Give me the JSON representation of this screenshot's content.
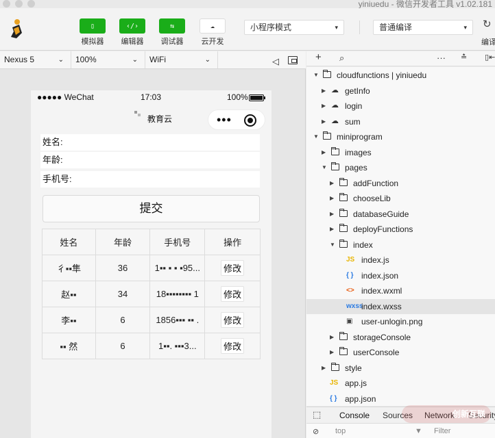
{
  "window": {
    "title": "yiniuedu - 微信开发者工具 v1.02.181"
  },
  "toolbar": {
    "buttons": [
      {
        "label": "模拟器",
        "icon": "phone-icon"
      },
      {
        "label": "编辑器",
        "icon": "code-icon"
      },
      {
        "label": "调试器",
        "icon": "debug-icon"
      },
      {
        "label": "云开发",
        "icon": "cloud-icon"
      }
    ],
    "mode_select": "小程序模式",
    "compile_select": "普通编译",
    "compile_label": "编译",
    "accent": "#1aad19"
  },
  "device_bar": {
    "device": "Nexus 5",
    "zoom": "100%",
    "network": "WiFi"
  },
  "phone": {
    "status": {
      "carrier": "●●●●● WeChat",
      "time": "17:03",
      "battery": "100%"
    },
    "nav_title": "教育云",
    "form": {
      "name_label": "姓名:",
      "age_label": "年龄:",
      "phone_label": "手机号:",
      "submit_label": "提交"
    },
    "table": {
      "headers": [
        "姓名",
        "年龄",
        "手机号",
        "操作"
      ],
      "rows": [
        {
          "name": "彳▪▪隼",
          "age": "36",
          "phone": "1▪▪ ▪ ▪ ▪95...",
          "action": "修改"
        },
        {
          "name": "赵▪▪",
          "age": "34",
          "phone": "18▪▪▪▪▪▪▪▪ 1",
          "action": "修改"
        },
        {
          "name": "李▪▪",
          "age": "6",
          "phone": "1856▪▪▪ ▪▪ .",
          "action": "修改"
        },
        {
          "name": "▪▪ 然",
          "age": "6",
          "phone": "1▪▪. ▪▪▪3...",
          "action": "修改"
        }
      ]
    }
  },
  "tree_toolbar": {
    "add": "+",
    "search": "⌕",
    "more": "···"
  },
  "tree": [
    {
      "label": "cloudfunctions | yiniuedu",
      "type": "cloudroot",
      "depth": 0,
      "expanded": true
    },
    {
      "label": "getInfo",
      "type": "cloud",
      "depth": 1,
      "expanded": false
    },
    {
      "label": "login",
      "type": "cloud",
      "depth": 1,
      "expanded": false
    },
    {
      "label": "sum",
      "type": "cloud",
      "depth": 1,
      "expanded": false
    },
    {
      "label": "miniprogram",
      "type": "folder",
      "depth": 0,
      "expanded": true
    },
    {
      "label": "images",
      "type": "folder",
      "depth": 1,
      "expanded": false
    },
    {
      "label": "pages",
      "type": "folder",
      "depth": 1,
      "expanded": true
    },
    {
      "label": "addFunction",
      "type": "folder",
      "depth": 2,
      "expanded": false
    },
    {
      "label": "chooseLib",
      "type": "folder",
      "depth": 2,
      "expanded": false
    },
    {
      "label": "databaseGuide",
      "type": "folder",
      "depth": 2,
      "expanded": false
    },
    {
      "label": "deployFunctions",
      "type": "folder",
      "depth": 2,
      "expanded": false
    },
    {
      "label": "index",
      "type": "folder",
      "depth": 2,
      "expanded": true
    },
    {
      "label": "index.js",
      "type": "js",
      "depth": 3
    },
    {
      "label": "index.json",
      "type": "json",
      "depth": 3
    },
    {
      "label": "index.wxml",
      "type": "wxml",
      "depth": 3
    },
    {
      "label": "index.wxss",
      "type": "wxss",
      "depth": 3,
      "selected": true
    },
    {
      "label": "user-unlogin.png",
      "type": "image",
      "depth": 3
    },
    {
      "label": "storageConsole",
      "type": "folder",
      "depth": 2,
      "expanded": false
    },
    {
      "label": "userConsole",
      "type": "folder",
      "depth": 2,
      "expanded": false
    },
    {
      "label": "style",
      "type": "folder",
      "depth": 1,
      "expanded": false
    },
    {
      "label": "app.js",
      "type": "js",
      "depth": 1
    },
    {
      "label": "app.json",
      "type": "json",
      "depth": 1
    }
  ],
  "console": {
    "tabs": [
      "Console",
      "Sources",
      "Network",
      "Security"
    ],
    "context": "top",
    "filter_placeholder": "Filter"
  },
  "watermark": "创新互联"
}
